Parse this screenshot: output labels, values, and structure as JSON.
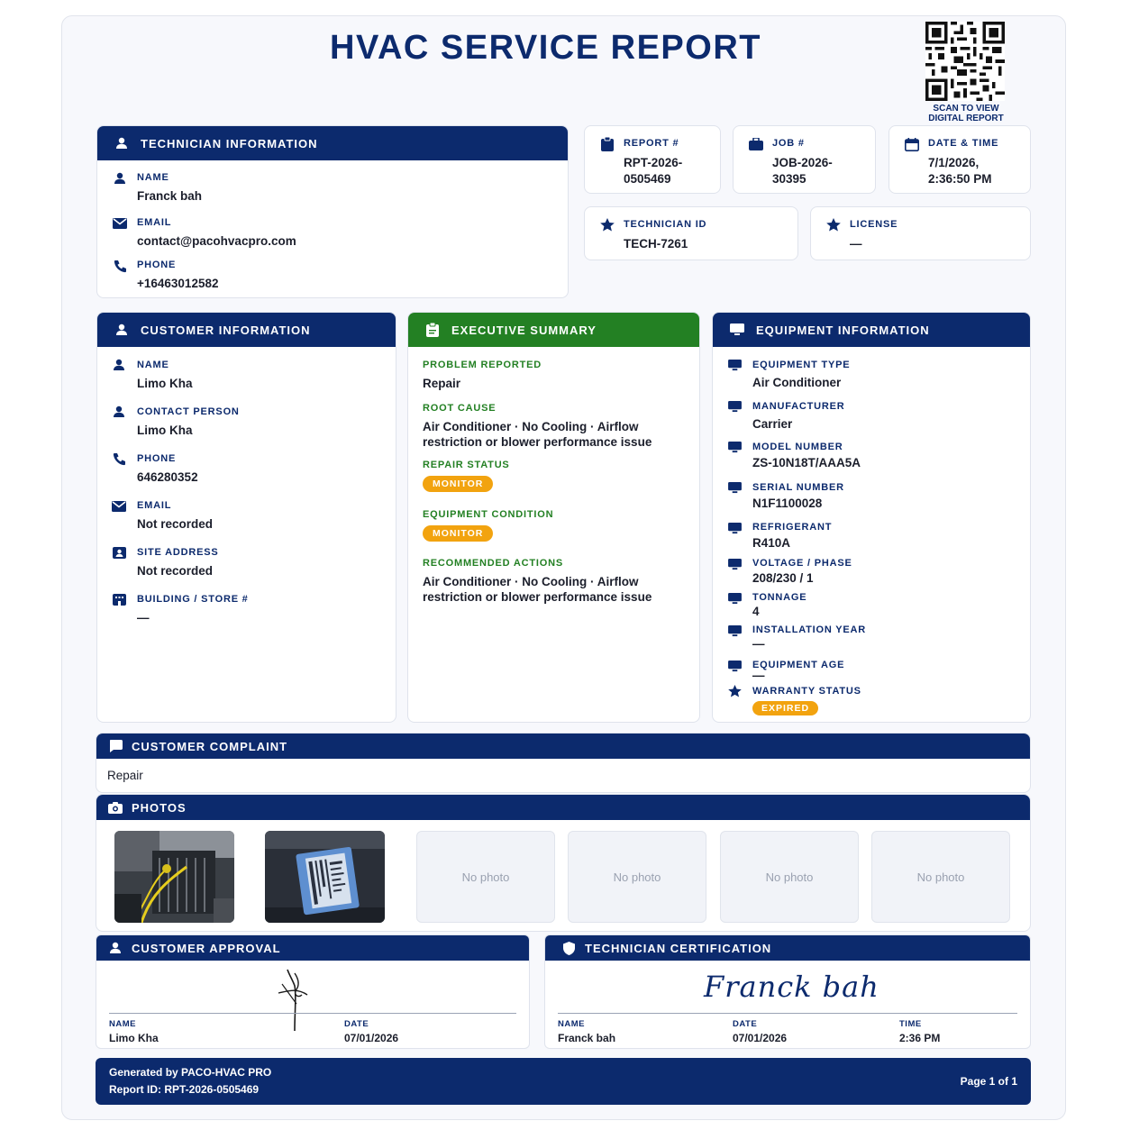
{
  "report_title": "HVAC SERVICE REPORT",
  "qr": {
    "caption": "SCAN TO VIEW DIGITAL REPORT"
  },
  "technician": {
    "header": "TECHNICIAN INFORMATION",
    "name_label": "NAME",
    "name": "Franck bah",
    "email_label": "EMAIL",
    "email": "contact@pacohvacpro.com",
    "phone_label": "PHONE",
    "phone": "+16463012582"
  },
  "meta": {
    "report_label": "REPORT #",
    "report_line1": "RPT-2026-",
    "report_line2": "0505469",
    "job_label": "JOB #",
    "job_line1": "JOB-2026-",
    "job_line2": "30395",
    "datetime_label": "DATE & TIME",
    "datetime_line1": "7/1/2026,",
    "datetime_line2": "2:36:50 PM",
    "techid_label": "TECHNICIAN ID",
    "techid": "TECH-7261",
    "license_label": "LICENSE",
    "license": "—"
  },
  "customer": {
    "header": "CUSTOMER INFORMATION",
    "name_label": "NAME",
    "name": "Limo Kha",
    "contact_label": "CONTACT PERSON",
    "contact": "Limo Kha",
    "phone_label": "PHONE",
    "phone": "646280352",
    "email_label": "EMAIL",
    "email": "Not recorded",
    "site_label": "SITE ADDRESS",
    "site": "Not recorded",
    "building_label": "BUILDING / STORE #",
    "building": "—"
  },
  "summary": {
    "header": "EXECUTIVE SUMMARY",
    "problem_label": "PROBLEM REPORTED",
    "problem": "Repair",
    "root_label": "ROOT CAUSE",
    "root_line1": "Air Conditioner · No Cooling · Airflow",
    "root_line2": "restriction or blower performance issue",
    "repair_label": "REPAIR STATUS",
    "repair_badge": "MONITOR",
    "condition_label": "EQUIPMENT CONDITION",
    "condition_badge": "MONITOR",
    "actions_label": "RECOMMENDED ACTIONS",
    "actions_line1": "Air Conditioner · No Cooling · Airflow",
    "actions_line2": "restriction or blower performance issue"
  },
  "equipment": {
    "header": "EQUIPMENT INFORMATION",
    "type_label": "EQUIPMENT TYPE",
    "type": "Air Conditioner",
    "mfr_label": "MANUFACTURER",
    "mfr": "Carrier",
    "model_label": "MODEL NUMBER",
    "model": "ZS-10N18T/AAA5A",
    "serial_label": "SERIAL NUMBER",
    "serial": "N1F1100028",
    "refrig_label": "REFRIGERANT",
    "refrig": "R410A",
    "voltage_label": "VOLTAGE / PHASE",
    "voltage": "208/230 / 1",
    "tonnage_label": "TONNAGE",
    "tonnage": "4",
    "year_label": "INSTALLATION YEAR",
    "year": "—",
    "age_label": "EQUIPMENT AGE",
    "age": "—",
    "warranty_label": "WARRANTY STATUS",
    "warranty_badge": "EXPIRED",
    "warranty_color": "#f2a30f"
  },
  "complaint": {
    "header": "CUSTOMER COMPLAINT",
    "text": "Repair"
  },
  "photos": {
    "header": "PHOTOS",
    "empty_label": "No photo"
  },
  "approval": {
    "header": "CUSTOMER APPROVAL",
    "name_label": "NAME",
    "name": "Limo Kha",
    "date_label": "DATE",
    "date": "07/01/2026"
  },
  "certification": {
    "header": "TECHNICIAN CERTIFICATION",
    "signature": "Franck bah",
    "name_label": "NAME",
    "name": "Franck bah",
    "date_label": "DATE",
    "date": "07/01/2026",
    "time_label": "TIME",
    "time": "2:36 PM"
  },
  "footer": {
    "generated": "Generated by PACO-HVAC PRO",
    "report_id": "Report ID: RPT-2026-0505469",
    "page": "Page 1 of 1"
  },
  "colors": {
    "navy": "#0c2a6d",
    "green": "#238023",
    "badge": "#f2a30f"
  }
}
